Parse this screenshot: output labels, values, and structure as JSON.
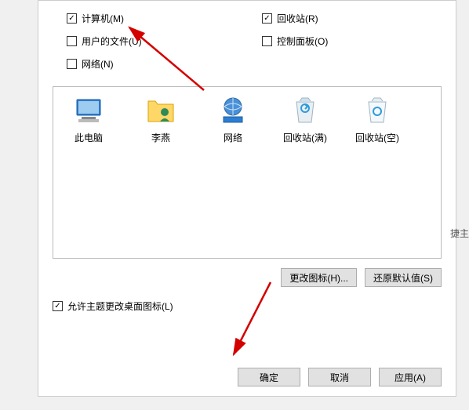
{
  "checkboxes": {
    "computer": {
      "label": "计算机(M)",
      "checked": true
    },
    "recycle": {
      "label": "回收站(R)",
      "checked": true
    },
    "userdocs": {
      "label": "用户的文件(U)",
      "checked": false
    },
    "control": {
      "label": "控制面板(O)",
      "checked": false
    },
    "network": {
      "label": "网络(N)",
      "checked": false
    }
  },
  "icons": {
    "thispc": "此电脑",
    "user": "李燕",
    "network": "网络",
    "bin_full": "回收站(满)",
    "bin_empty": "回收站(空)"
  },
  "buttons": {
    "change_icon": "更改图标(H)...",
    "restore_default": "还原默认值(S)",
    "ok": "确定",
    "cancel": "取消",
    "apply": "应用(A)"
  },
  "allow_theme_label": "允许主题更改桌面图标(L)",
  "cropped_side_text": "捷主"
}
